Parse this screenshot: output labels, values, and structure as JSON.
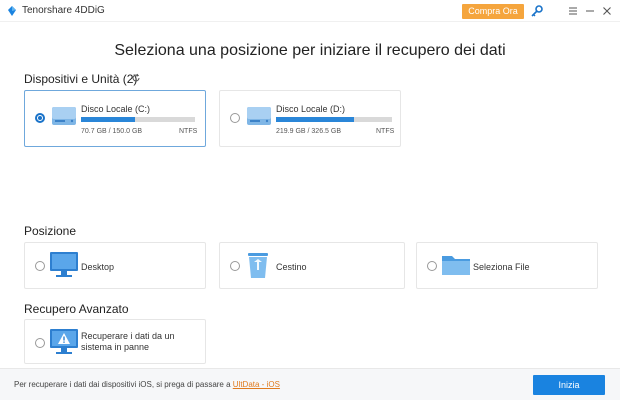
{
  "titlebar": {
    "app_title": "Tenorshare 4DDiG",
    "buy_label": "Compra Ora"
  },
  "main_title": "Seleziona una posizione per iniziare il recupero dei dati",
  "devices": {
    "title": "Dispositivi e Unità (2)",
    "disks": [
      {
        "name": "Disco Locale (C:)",
        "size": "70.7 GB / 150.0 GB",
        "fs": "NTFS",
        "used_fraction": 0.471,
        "selected": true
      },
      {
        "name": "Disco Locale (D:)",
        "size": "219.9 GB / 326.5 GB",
        "fs": "NTFS",
        "used_fraction": 0.674,
        "selected": false
      }
    ]
  },
  "positions": {
    "title": "Posizione",
    "items": [
      {
        "label": "Desktop",
        "icon": "monitor-icon"
      },
      {
        "label": "Cestino",
        "icon": "recycle-bin-icon"
      },
      {
        "label": "Seleziona File",
        "icon": "folder-icon"
      }
    ]
  },
  "advanced": {
    "title": "Recupero Avanzato",
    "item_label": "Recuperare i dati da un sistema in panne",
    "icon": "warning-monitor-icon"
  },
  "footer": {
    "text": "Per recuperare i dati dai dispositivi iOS, si prega di passare a",
    "link": "UltData - iOS",
    "start_label": "Inizia"
  },
  "colors": {
    "accent": "#1a83e0",
    "buy": "#f5a53d",
    "link": "#e07b1f",
    "bar_fill": "#2a86d8"
  }
}
